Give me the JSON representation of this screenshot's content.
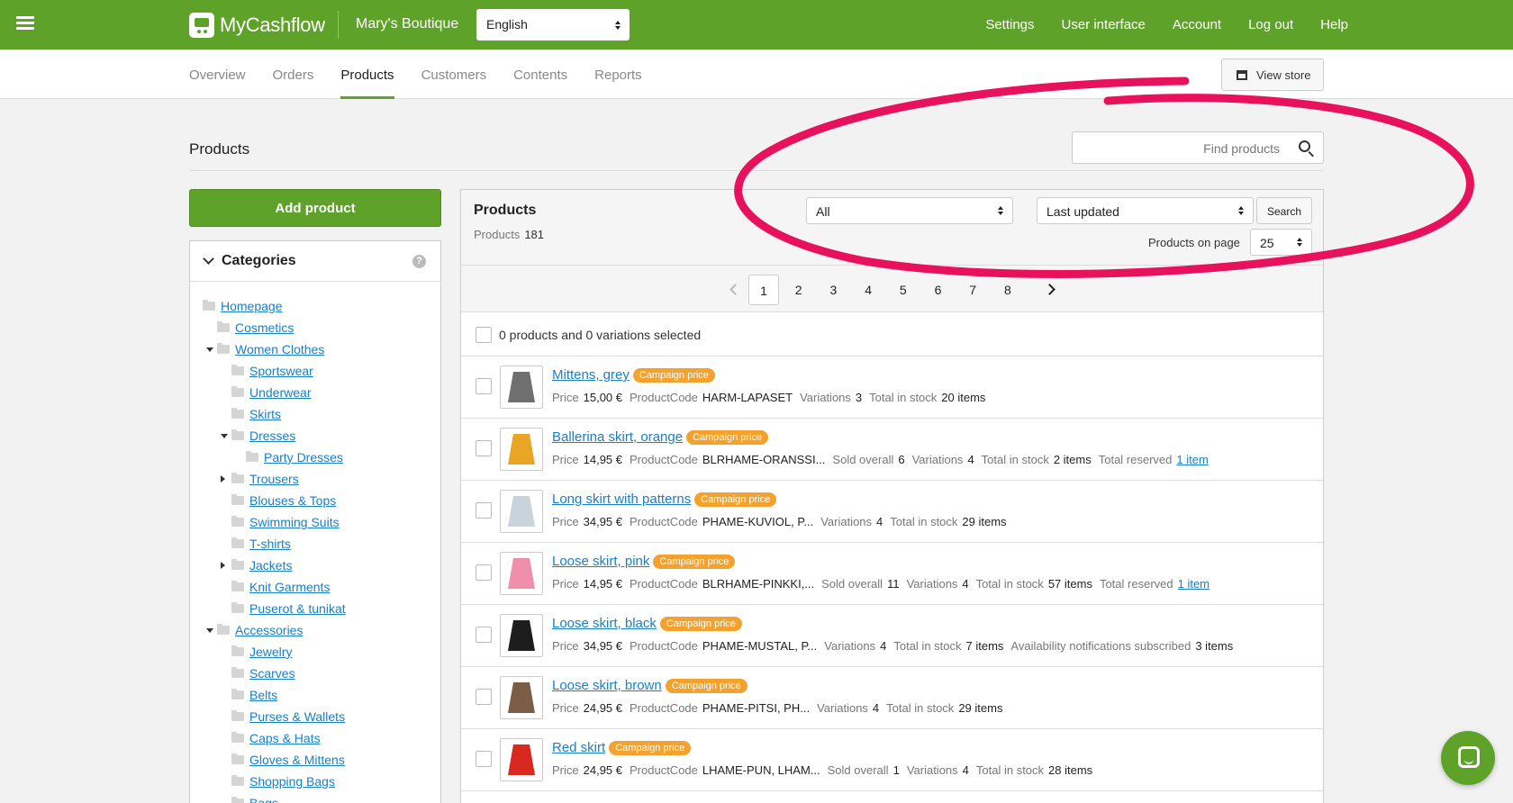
{
  "app": {
    "logo": "MyCashflow",
    "store_name": "Mary's Boutique",
    "language": "English"
  },
  "topnav": [
    "Settings",
    "User interface",
    "Account",
    "Log out",
    "Help"
  ],
  "tabs": [
    "Overview",
    "Orders",
    "Products",
    "Customers",
    "Contents",
    "Reports"
  ],
  "active_tab": "Products",
  "view_store": "View store",
  "page_title": "Products",
  "find_placeholder": "Find products",
  "add_product": "Add product",
  "categories": {
    "title": "Categories",
    "help": "?",
    "items": [
      {
        "label": "Homepage",
        "level": 0,
        "toggle": ""
      },
      {
        "label": "Cosmetics",
        "level": 1,
        "toggle": ""
      },
      {
        "label": "Women Clothes",
        "level": 1,
        "toggle": "open"
      },
      {
        "label": "Sportswear",
        "level": 2,
        "toggle": ""
      },
      {
        "label": "Underwear",
        "level": 2,
        "toggle": ""
      },
      {
        "label": "Skirts",
        "level": 2,
        "toggle": ""
      },
      {
        "label": "Dresses",
        "level": 2,
        "toggle": "open"
      },
      {
        "label": "Party Dresses",
        "level": 3,
        "toggle": ""
      },
      {
        "label": "Trousers",
        "level": 2,
        "toggle": "closed"
      },
      {
        "label": "Blouses & Tops",
        "level": 2,
        "toggle": ""
      },
      {
        "label": "Swimming Suits",
        "level": 2,
        "toggle": ""
      },
      {
        "label": "T-shirts",
        "level": 2,
        "toggle": ""
      },
      {
        "label": "Jackets",
        "level": 2,
        "toggle": "closed"
      },
      {
        "label": "Knit Garments",
        "level": 2,
        "toggle": ""
      },
      {
        "label": "Puserot & tunikat",
        "level": 2,
        "toggle": ""
      },
      {
        "label": "Accessories",
        "level": 1,
        "toggle": "open"
      },
      {
        "label": "Jewelry",
        "level": 2,
        "toggle": ""
      },
      {
        "label": "Scarves",
        "level": 2,
        "toggle": ""
      },
      {
        "label": "Belts",
        "level": 2,
        "toggle": ""
      },
      {
        "label": "Purses & Wallets",
        "level": 2,
        "toggle": ""
      },
      {
        "label": "Caps & Hats",
        "level": 2,
        "toggle": ""
      },
      {
        "label": "Gloves & Mittens",
        "level": 2,
        "toggle": ""
      },
      {
        "label": "Shopping Bags",
        "level": 2,
        "toggle": ""
      },
      {
        "label": "Bags",
        "level": 2,
        "toggle": ""
      }
    ]
  },
  "products_panel": {
    "title": "Products",
    "count_label": "Products",
    "count": "181",
    "filter": "All",
    "sort": "Last updated",
    "search_button": "Search",
    "per_page_label": "Products on page",
    "per_page": "25",
    "pages": [
      "1",
      "2",
      "3",
      "4",
      "5",
      "6",
      "7",
      "8"
    ],
    "current_page": "1",
    "selection_text": "0 products and 0 variations selected"
  },
  "products": [
    {
      "name": "Mittens, grey",
      "badge": "Campaign price",
      "color": "#6f6f6f",
      "meta": [
        [
          "Price",
          "15,00 €"
        ],
        [
          "ProductCode",
          "HARM-LAPASET"
        ],
        [
          "Variations",
          "3"
        ],
        [
          "Total in stock",
          "20 items"
        ]
      ]
    },
    {
      "name": "Ballerina skirt, orange",
      "badge": "Campaign price",
      "color": "#e9a524",
      "meta": [
        [
          "Price",
          "14,95 €"
        ],
        [
          "ProductCode",
          "BLRHAME-ORANSSI..."
        ],
        [
          "Sold overall",
          "6"
        ],
        [
          "Variations",
          "4"
        ],
        [
          "Total in stock",
          "2 items"
        ],
        [
          "Total reserved",
          ""
        ]
      ],
      "link": "1 item"
    },
    {
      "name": "Long skirt with patterns",
      "badge": "Campaign price",
      "color": "#c9d3db",
      "meta": [
        [
          "Price",
          "34,95 €"
        ],
        [
          "ProductCode",
          "PHAME-KUVIOL, P..."
        ],
        [
          "Variations",
          "4"
        ],
        [
          "Total in stock",
          "29 items"
        ]
      ]
    },
    {
      "name": "Loose skirt, pink",
      "badge": "Campaign price",
      "color": "#f08fab",
      "meta": [
        [
          "Price",
          "14,95 €"
        ],
        [
          "ProductCode",
          "BLRHAME-PINKKI,..."
        ],
        [
          "Sold overall",
          "11"
        ],
        [
          "Variations",
          "4"
        ],
        [
          "Total in stock",
          "57 items"
        ],
        [
          "Total reserved",
          ""
        ]
      ],
      "link": "1 item"
    },
    {
      "name": "Loose skirt, black",
      "badge": "Campaign price",
      "color": "#1d1d1d",
      "meta": [
        [
          "Price",
          "34,95 €"
        ],
        [
          "ProductCode",
          "PHAME-MUSTAL, P..."
        ],
        [
          "Variations",
          "4"
        ],
        [
          "Total in stock",
          "7 items"
        ],
        [
          "Availability notifications subscribed",
          "3 items"
        ]
      ]
    },
    {
      "name": "Loose skirt, brown",
      "badge": "Campaign price",
      "color": "#7b5d46",
      "meta": [
        [
          "Price",
          "24,95 €"
        ],
        [
          "ProductCode",
          "PHAME-PITSI, PH..."
        ],
        [
          "Variations",
          "4"
        ],
        [
          "Total in stock",
          "29 items"
        ]
      ]
    },
    {
      "name": "Red skirt",
      "badge": "Campaign price",
      "color": "#d7291f",
      "meta": [
        [
          "Price",
          "24,95 €"
        ],
        [
          "ProductCode",
          "LHAME-PUN, LHAM..."
        ],
        [
          "Sold overall",
          "1"
        ],
        [
          "Variations",
          "4"
        ],
        [
          "Total in stock",
          "28 items"
        ]
      ]
    }
  ],
  "colors": {
    "brand": "#5ea22a",
    "badge": "#f4a22d",
    "link": "#1a7fc4",
    "annotation": "#e8125c"
  }
}
